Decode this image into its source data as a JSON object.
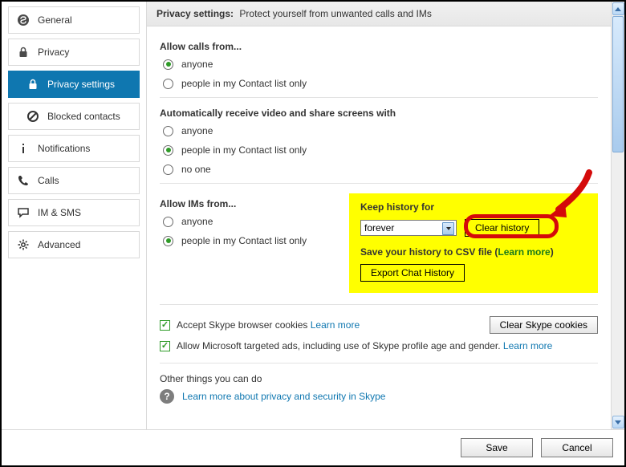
{
  "sidebar": {
    "items": [
      {
        "label": "General"
      },
      {
        "label": "Privacy"
      },
      {
        "label": "Privacy settings"
      },
      {
        "label": "Blocked contacts"
      },
      {
        "label": "Notifications"
      },
      {
        "label": "Calls"
      },
      {
        "label": "IM & SMS"
      },
      {
        "label": "Advanced"
      }
    ]
  },
  "header": {
    "title": "Privacy settings:",
    "subtitle": "Protect yourself from unwanted calls and IMs"
  },
  "calls": {
    "title": "Allow calls from...",
    "opt1": "anyone",
    "opt2": "people in my Contact list only"
  },
  "video": {
    "title": "Automatically receive video and share screens with",
    "opt1": "anyone",
    "opt2": "people in my Contact list only",
    "opt3": "no one"
  },
  "ims": {
    "title": "Allow IMs from...",
    "opt1": "anyone",
    "opt2": "people in my Contact list only"
  },
  "history": {
    "title": "Keep history for",
    "selected": "forever",
    "clearBtn": "Clear history",
    "saveLine1": "Save your history to CSV file (",
    "learnMore": "Learn more",
    "saveLine2": ")",
    "exportBtn": "Export Chat History"
  },
  "cookies": {
    "acceptLabel": "Accept Skype browser cookies",
    "acceptLearn": "Learn more",
    "clearBtn": "Clear Skype cookies",
    "adsLabel": "Allow Microsoft targeted ads, including use of Skype profile age and gender.",
    "adsLearn": "Learn more"
  },
  "other": {
    "title": "Other things you can do",
    "link": "Learn more about privacy and security in Skype"
  },
  "footer": {
    "save": "Save",
    "cancel": "Cancel"
  }
}
